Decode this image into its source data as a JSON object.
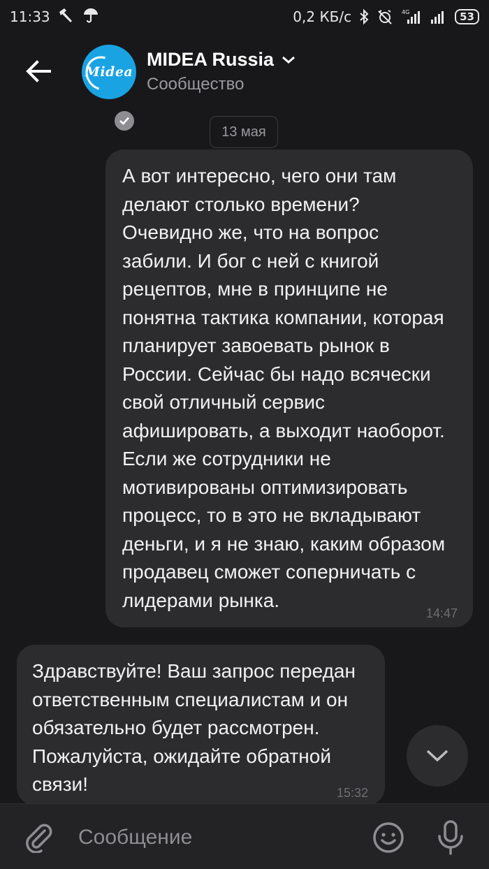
{
  "status_bar": {
    "time": "11:33",
    "net_speed": "0,2 КБ/с",
    "network_type": "4G",
    "battery": "53",
    "icons": [
      "hammer-icon",
      "umbrella-icon",
      "bluetooth-icon",
      "alarm-off-icon",
      "signal-icon",
      "signal-icon",
      "battery-icon"
    ]
  },
  "header": {
    "title": "MIDEA Russia",
    "subtitle": "Сообщество",
    "avatar_logo_text": "Midea",
    "icons": [
      "back-arrow-icon",
      "chevron-down-icon",
      "verified-check-icon"
    ]
  },
  "date_separator": "13 мая",
  "messages": [
    {
      "direction": "outgoing",
      "text": "А вот интересно, чего они там делают столько времени? Очевидно же, что на вопрос забили. И бог с ней с книгой рецептов, мне в принципе не понятна тактика компании, которая планирует завоевать рынок в России. Сейчас бы надо всячески свой отличный сервис афишировать, а выходит наоборот. Если же сотрудники не мотивированы оптимизировать процесс, то в это не вкладывают деньги, и я не знаю, каким образом продавец сможет соперничать с лидерами рынка.",
      "time": "14:47"
    },
    {
      "direction": "incoming",
      "text": "Здравствуйте! Ваш запрос передан ответственным специалистам и он обязательно будет рассмотрен. Пожалуйста, ожидайте обратной связи!",
      "time": "15:32"
    }
  ],
  "composer": {
    "placeholder": "Сообщение",
    "icons": [
      "paperclip-icon",
      "emoji-icon",
      "microphone-icon"
    ]
  },
  "colors": {
    "background": "#18181a",
    "bubble": "#2c2c2e",
    "composer": "#232325",
    "avatar": "#1aa3e3",
    "secondary_text": "#9a9a9e"
  }
}
